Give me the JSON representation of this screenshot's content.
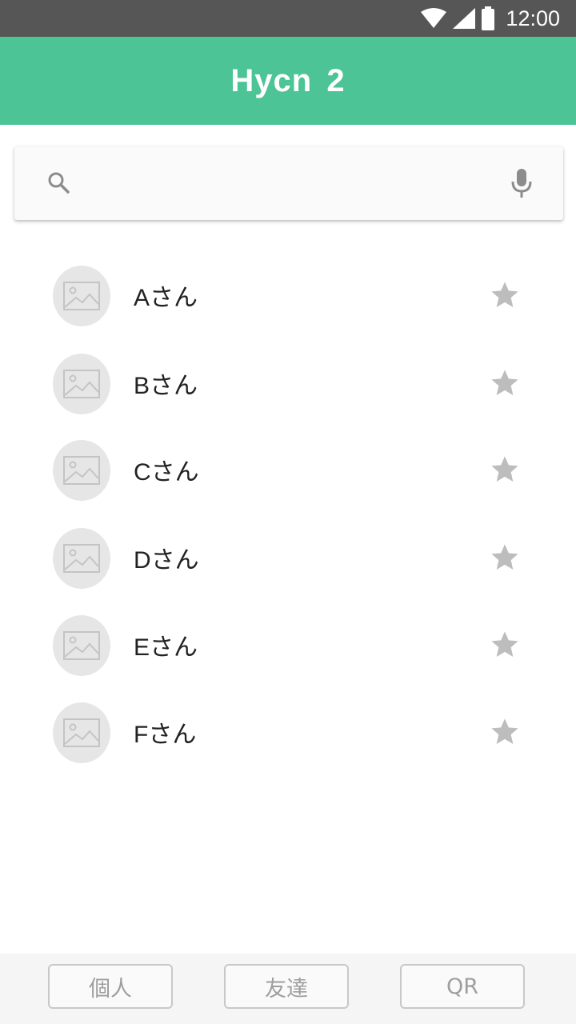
{
  "status_bar": {
    "time": "12:00",
    "icons": [
      "wifi-icon",
      "signal-icon",
      "battery-icon"
    ]
  },
  "app_bar": {
    "title": "Hycn 2"
  },
  "search": {
    "placeholder": "",
    "value": "",
    "left_icon": "search-icon",
    "right_icon": "mic-icon"
  },
  "contacts": [
    {
      "name": "Aさん",
      "starred": false
    },
    {
      "name": "Bさん",
      "starred": false
    },
    {
      "name": "Cさん",
      "starred": false
    },
    {
      "name": "Dさん",
      "starred": false
    },
    {
      "name": "Eさん",
      "starred": false
    },
    {
      "name": "Fさん",
      "starred": false
    }
  ],
  "bottom_tabs": [
    {
      "label": "個人"
    },
    {
      "label": "友達"
    },
    {
      "label": "QR"
    }
  ],
  "colors": {
    "accent": "#4cc496",
    "status_bar": "#575656",
    "star": "#bdbdbd",
    "avatar_bg": "#e6e6e6"
  }
}
